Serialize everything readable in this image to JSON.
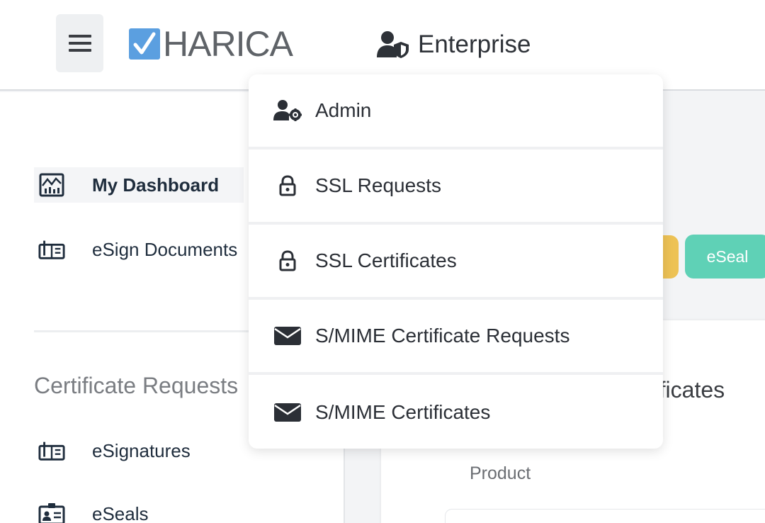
{
  "header": {
    "menu_icon": "hamburger-icon",
    "logo_text": "HARICA",
    "enterprise_label": "Enterprise",
    "enterprise_icon": "user-shield-icon"
  },
  "sidebar": {
    "items": [
      {
        "label": "My Dashboard",
        "icon": "dashboard-chart-icon",
        "active": true
      },
      {
        "label": "eSign Documents",
        "icon": "esign-document-icon",
        "active": false
      }
    ],
    "section_title": "Certificate Requests",
    "section_items": [
      {
        "label": "eSignatures",
        "icon": "esignature-icon"
      },
      {
        "label": "eSeals",
        "icon": "eseal-id-card-icon"
      }
    ]
  },
  "main": {
    "eseal_button": "eSeal",
    "card_title_partial": "rtificates",
    "product_label": "Product"
  },
  "dropdown": {
    "items": [
      {
        "label": "Admin",
        "icon": "user-gear-icon"
      },
      {
        "label": "SSL Requests",
        "icon": "lock-icon"
      },
      {
        "label": "SSL Certificates",
        "icon": "lock-icon"
      },
      {
        "label": "S/MIME Certificate Requests",
        "icon": "envelope-icon"
      },
      {
        "label": "S/MIME Certificates",
        "icon": "envelope-icon"
      }
    ]
  },
  "colors": {
    "logo_check": "#5b9fe0",
    "eseal_pill": "#5fd1b6",
    "yellow_pill": "#edc255",
    "nav_text": "#1f2d3d"
  }
}
